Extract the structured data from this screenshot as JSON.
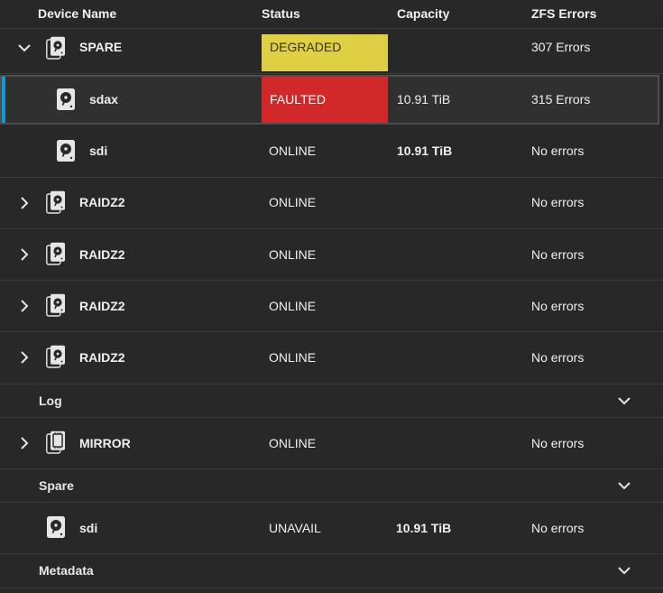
{
  "columns": {
    "device_name": "Device Name",
    "status": "Status",
    "capacity": "Capacity",
    "zfs_errors": "ZFS Errors"
  },
  "rows": [
    {
      "name": "SPARE",
      "status": "DEGRADED",
      "capacity": "",
      "errors": "307 Errors"
    },
    {
      "name": "sdax",
      "status": "FAULTED",
      "capacity": "10.91 TiB",
      "errors": "315 Errors"
    },
    {
      "name": "sdi",
      "status": "ONLINE",
      "capacity": "10.91 TiB",
      "errors": "No errors"
    },
    {
      "name": "RAIDZ2",
      "status": "ONLINE",
      "capacity": "",
      "errors": "No errors"
    },
    {
      "name": "RAIDZ2",
      "status": "ONLINE",
      "capacity": "",
      "errors": "No errors"
    },
    {
      "name": "RAIDZ2",
      "status": "ONLINE",
      "capacity": "",
      "errors": "No errors"
    },
    {
      "name": "RAIDZ2",
      "status": "ONLINE",
      "capacity": "",
      "errors": "No errors"
    }
  ],
  "sections": {
    "log": "Log",
    "spare": "Spare",
    "metadata": "Metadata"
  },
  "log_rows": [
    {
      "name": "MIRROR",
      "status": "ONLINE",
      "capacity": "",
      "errors": "No errors"
    }
  ],
  "spare_rows": [
    {
      "name": "sdi",
      "status": "UNAVAIL",
      "capacity": "10.91 TiB",
      "errors": "No errors"
    }
  ],
  "colors": {
    "background": "#282828",
    "degraded": "#dfcf44",
    "faulted": "#d12929",
    "selection_accent": "#0e9bd8"
  },
  "icons": {
    "expand": "chevron-right-icon",
    "collapse": "chevron-down-icon",
    "group_disk": "disk-group-icon",
    "disk": "hard-disk-icon",
    "mirror": "mirror-vdev-icon"
  }
}
